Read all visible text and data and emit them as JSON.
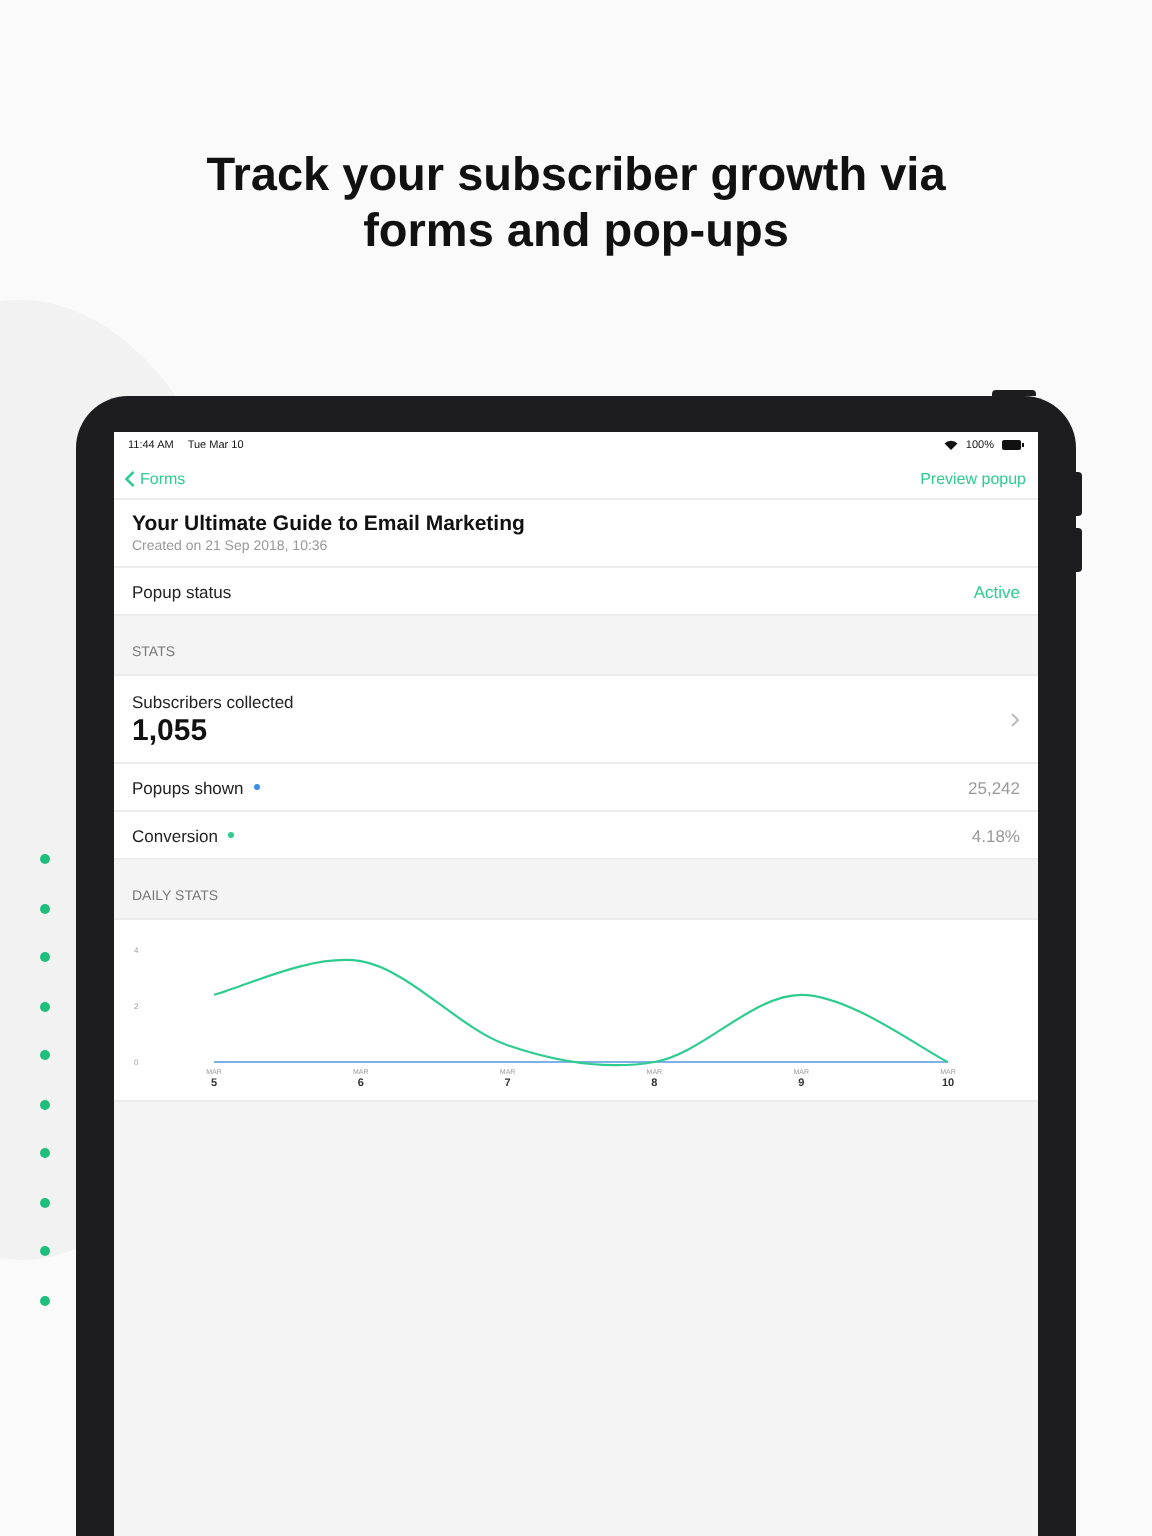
{
  "headline": "Track your subscriber growth via forms and pop-ups",
  "status_bar": {
    "time": "11:44 AM",
    "date": "Tue Mar 10",
    "battery": "100%"
  },
  "nav": {
    "back": "Forms",
    "action": "Preview popup"
  },
  "form": {
    "title": "Your Ultimate Guide to Email Marketing",
    "created": "Created on 21 Sep 2018, 10:36"
  },
  "status_row": {
    "label": "Popup status",
    "value": "Active"
  },
  "stats_header": "STATS",
  "subscribers": {
    "label": "Subscribers collected",
    "value": "1,055"
  },
  "metrics": [
    {
      "label": "Popups shown",
      "color": "#3a8ee6",
      "value": "25,242"
    },
    {
      "label": "Conversion",
      "color": "#2ecc8f",
      "value": "4.18%"
    }
  ],
  "daily_header": "DAILY STATS",
  "daily_chart": {
    "month_labels": [
      "MAR",
      "MAR",
      "MAR",
      "MAR",
      "MAR",
      "MAR"
    ],
    "chart_data": {
      "type": "line",
      "categories": [
        "5",
        "6",
        "7",
        "8",
        "9",
        "10"
      ],
      "yticks": [
        0,
        2,
        4
      ],
      "ylim": [
        0,
        4
      ],
      "series": [
        {
          "color": "#2ecc8f",
          "values": [
            2.4,
            3.6,
            0.6,
            0,
            2.4,
            0
          ]
        },
        {
          "color": "#7fb0e8",
          "values": [
            0,
            0,
            0,
            0,
            0,
            0
          ]
        }
      ]
    }
  }
}
